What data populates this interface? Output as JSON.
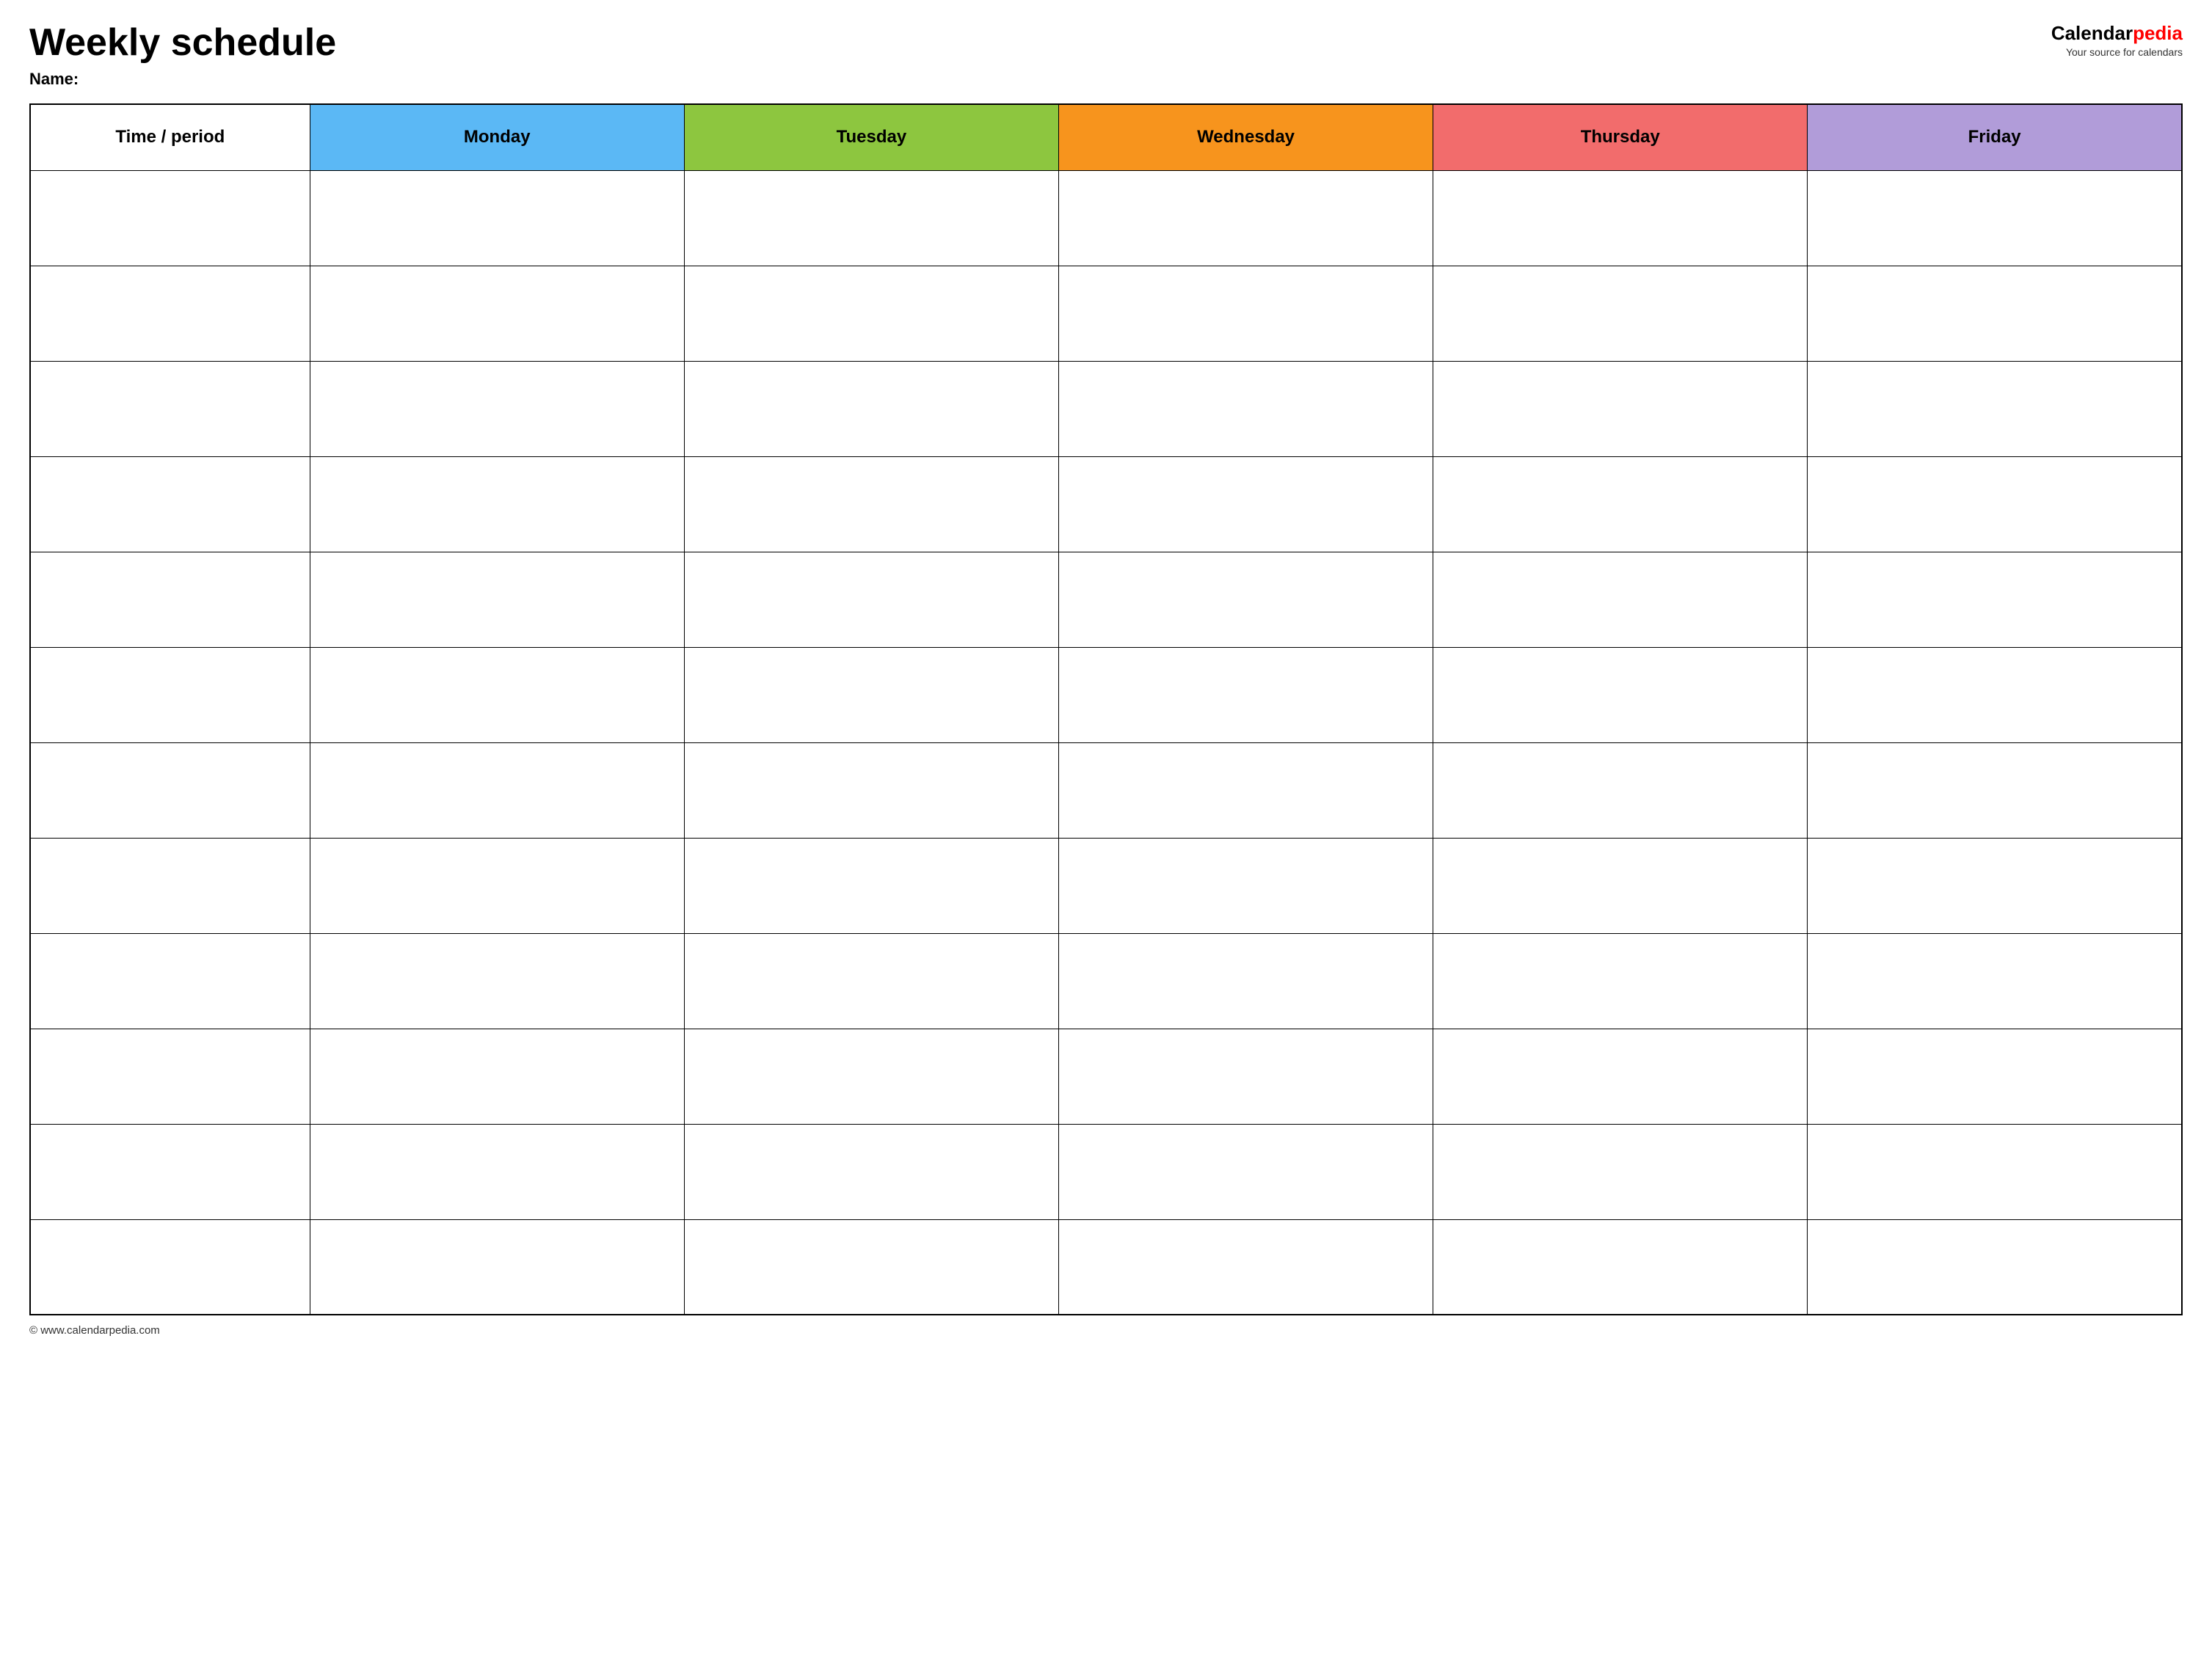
{
  "header": {
    "title": "Weekly schedule",
    "name_label": "Name:",
    "logo": {
      "calendar_part": "Calendar",
      "pedia_part": "pedia",
      "tagline": "Your source for calendars"
    }
  },
  "table": {
    "columns": [
      {
        "id": "time",
        "label": "Time / period",
        "color": "#ffffff"
      },
      {
        "id": "monday",
        "label": "Monday",
        "color": "#5bb8f5"
      },
      {
        "id": "tuesday",
        "label": "Tuesday",
        "color": "#8dc63f"
      },
      {
        "id": "wednesday",
        "label": "Wednesday",
        "color": "#f7941d"
      },
      {
        "id": "thursday",
        "label": "Thursday",
        "color": "#f26c6c"
      },
      {
        "id": "friday",
        "label": "Friday",
        "color": "#b19cd9"
      }
    ],
    "row_count": 12
  },
  "footer": {
    "url": "© www.calendarpedia.com"
  }
}
